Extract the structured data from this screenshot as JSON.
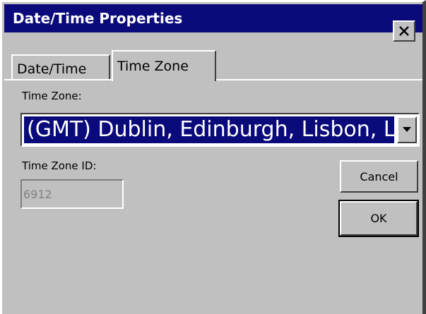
{
  "window": {
    "title": "Date/Time Properties",
    "close_icon": "close-icon"
  },
  "tabs": [
    {
      "label": "Date/Time",
      "selected": false
    },
    {
      "label": "Time Zone",
      "selected": true
    }
  ],
  "time_zone": {
    "label": "Time Zone:",
    "selected_value": "(GMT) Dublin, Edinburgh, Lisbon, London",
    "dropdown_icon": "chevron-down-icon"
  },
  "time_zone_id": {
    "label": "Time Zone ID:",
    "value": "6912"
  },
  "buttons": {
    "cancel": "Cancel",
    "ok": "OK"
  },
  "colors": {
    "titlebar": "#0a0a7a",
    "face": "#c0c0c0",
    "selection": "#0a0a7a"
  }
}
